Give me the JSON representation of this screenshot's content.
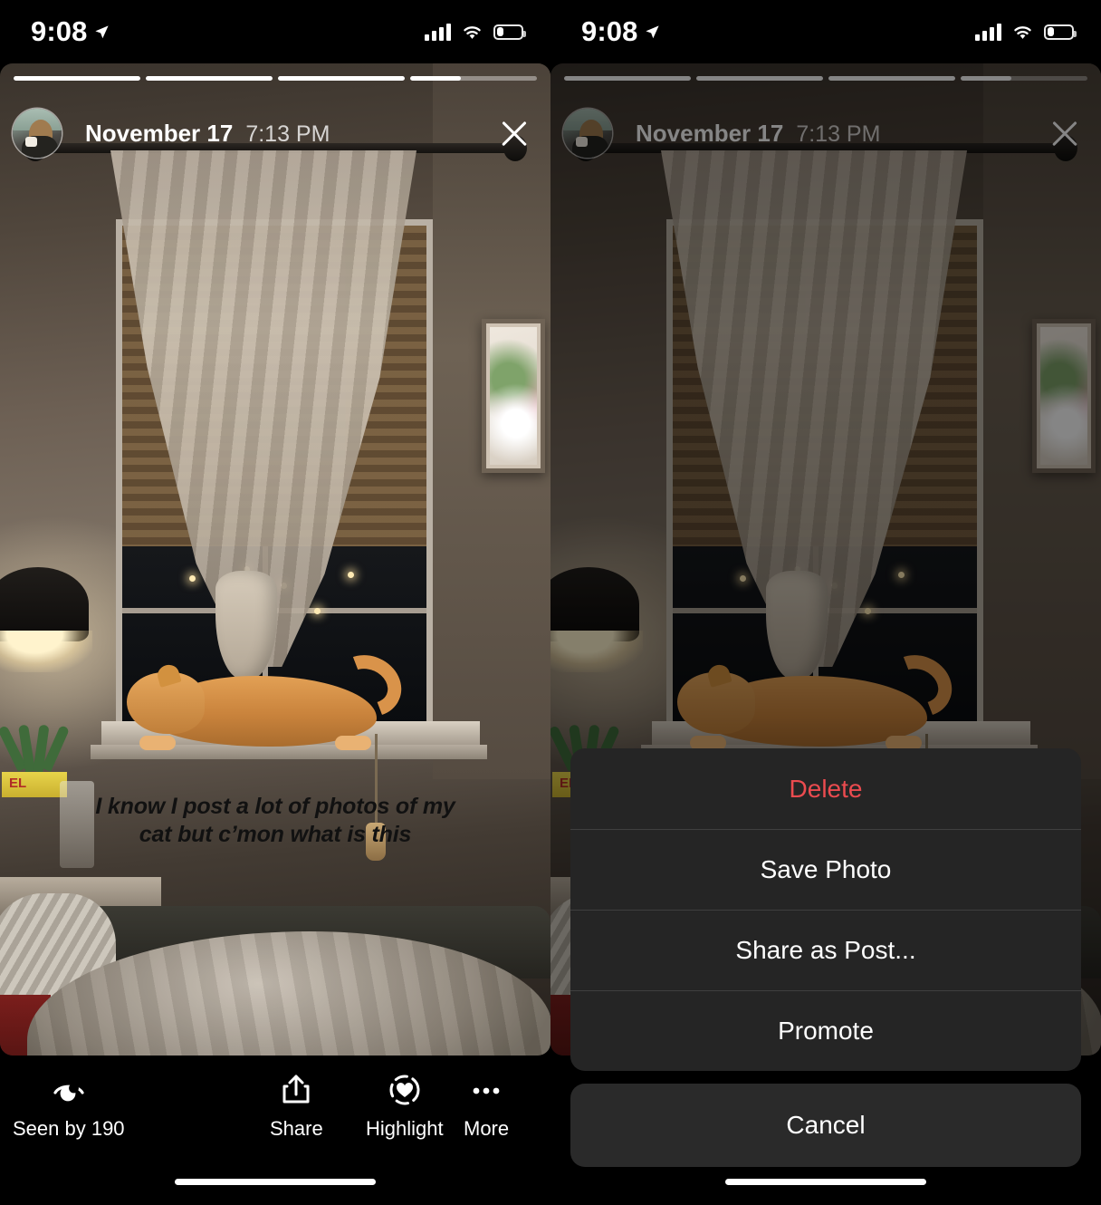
{
  "status_bar": {
    "time": "9:08",
    "location_icon": "location-arrow-icon",
    "signal_icon": "cellular-signal-icon",
    "wifi_icon": "wifi-icon",
    "battery_icon": "battery-icon",
    "battery_level_percent": 25
  },
  "story": {
    "progress_segments": [
      100,
      100,
      100,
      40
    ],
    "avatar": "profile-avatar",
    "date": "November 17",
    "time": "7:13 PM",
    "close_icon": "close-icon",
    "overlay_text": "I know I post a lot of photos of my cat but c’mon what is this"
  },
  "toolbar": {
    "seen": {
      "icon": "eye-icon",
      "label": "Seen by 190",
      "count": 190
    },
    "share": {
      "icon": "share-icon",
      "label": "Share"
    },
    "highlight": {
      "icon": "highlight-heart-icon",
      "label": "Highlight"
    },
    "more": {
      "icon": "more-dots-icon",
      "label": "More"
    }
  },
  "action_sheet": {
    "items": [
      {
        "label": "Delete",
        "style": "destructive"
      },
      {
        "label": "Save Photo",
        "style": "default"
      },
      {
        "label": "Share as Post...",
        "style": "default"
      },
      {
        "label": "Promote",
        "style": "default"
      }
    ],
    "cancel_label": "Cancel"
  },
  "colors": {
    "destructive": "#eb4b4f",
    "sheet_background": "#252525",
    "cancel_background": "#2a2a2a",
    "screen_background": "#000000",
    "text_primary": "#ffffff"
  }
}
